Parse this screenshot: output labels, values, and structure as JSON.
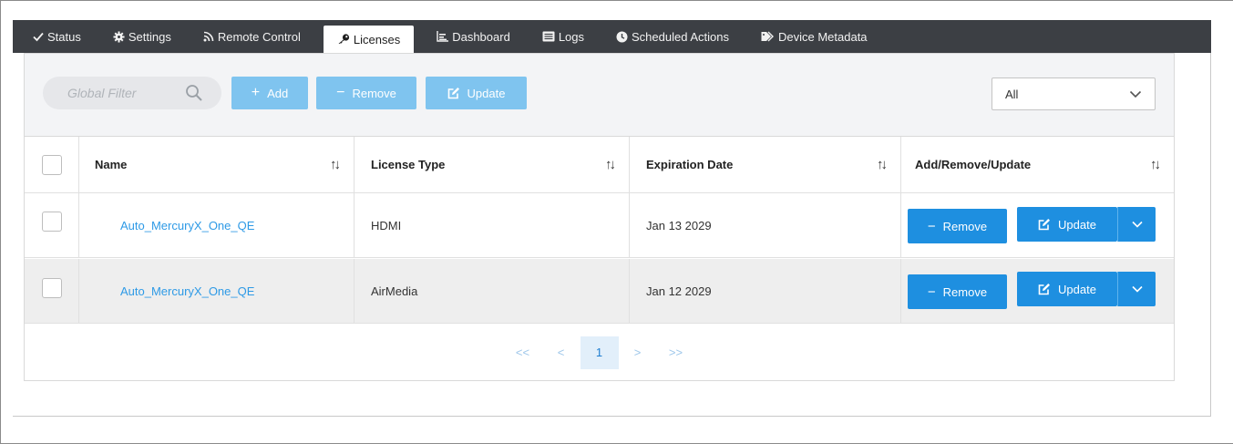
{
  "tabs": [
    {
      "icon": "check-icon",
      "glyph": "✓",
      "label": "Status"
    },
    {
      "icon": "gear-icon",
      "glyph": "✱",
      "label": "Settings"
    },
    {
      "icon": "rss-icon",
      "glyph": "\u0001",
      "label": "Remote Control"
    },
    {
      "icon": "key-icon",
      "glyph": "",
      "label": "Licenses",
      "active": true
    },
    {
      "icon": "area-chart-icon",
      "glyph": "",
      "label": "Dashboard"
    },
    {
      "icon": "list-icon",
      "glyph": "",
      "label": "Logs"
    },
    {
      "icon": "clock-icon",
      "glyph": "",
      "label": "Scheduled Actions"
    },
    {
      "icon": "tag-icon",
      "glyph": "",
      "label": "Device Metadata"
    }
  ],
  "toolbar": {
    "filter_placeholder": "Global Filter",
    "add_label": "Add",
    "remove_label": "Remove",
    "update_label": "Update",
    "select_value": "All"
  },
  "table": {
    "headers": [
      "Name",
      "License Type",
      "Expiration Date",
      "Add/Remove/Update"
    ],
    "rows": [
      {
        "name": "Auto_MercuryX_One_QE",
        "type": "HDMI",
        "expiration": "Jan 13 2029"
      },
      {
        "name": "Auto_MercuryX_One_QE",
        "type": "AirMedia",
        "expiration": "Jan 12 2029"
      }
    ],
    "row_remove_label": "Remove",
    "row_update_label": "Update"
  },
  "pager": {
    "first": "<<",
    "prev": "<",
    "current": "1",
    "next": ">",
    "last": ">>"
  },
  "colors": {
    "tabbar": "#3c3f44",
    "primary": "#1e8fe0",
    "disabled": "#7fc4ef",
    "link": "#2e9ae6"
  }
}
